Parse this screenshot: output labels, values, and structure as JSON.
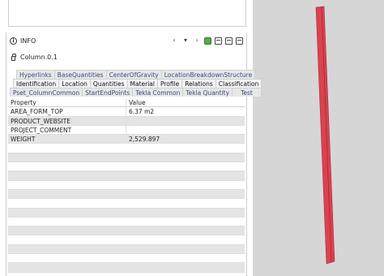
{
  "panel": {
    "title": "INFO",
    "object_name": "Column.0.1"
  },
  "toolbar": {
    "icons": [
      "chevron-left-icon",
      "chevron-down-icon",
      "chevron-right-icon",
      "green-select-icon",
      "copy-icon",
      "paste-icon",
      "window-icon"
    ]
  },
  "tabs": {
    "row1": [
      "Hyperlinks",
      "BaseQuantities",
      "CenterOfGravity",
      "LocationBreakdownStructure"
    ],
    "row2": [
      "Identification",
      "Location",
      "Quantities",
      "Material",
      "Profile",
      "Relations",
      "Classification"
    ],
    "row3": [
      "Pset_ColumnCommon",
      "StartEndPoints",
      "Tekla Common",
      "Tekla Quantity",
      "Test"
    ],
    "active": "Test"
  },
  "table": {
    "headers": {
      "property": "Property",
      "value": "Value"
    },
    "rows": [
      {
        "property": "AREA_FORM_TOP",
        "value": "6.37 m2"
      },
      {
        "property": "PRODUCT_WEBSITE",
        "value": ""
      },
      {
        "property": "PROJECT_COMMENT",
        "value": ""
      },
      {
        "property": "WEIGHT",
        "value": "2,529.897"
      }
    ]
  },
  "colors": {
    "beam": "#d9434e",
    "highlight": "#ffff66"
  }
}
